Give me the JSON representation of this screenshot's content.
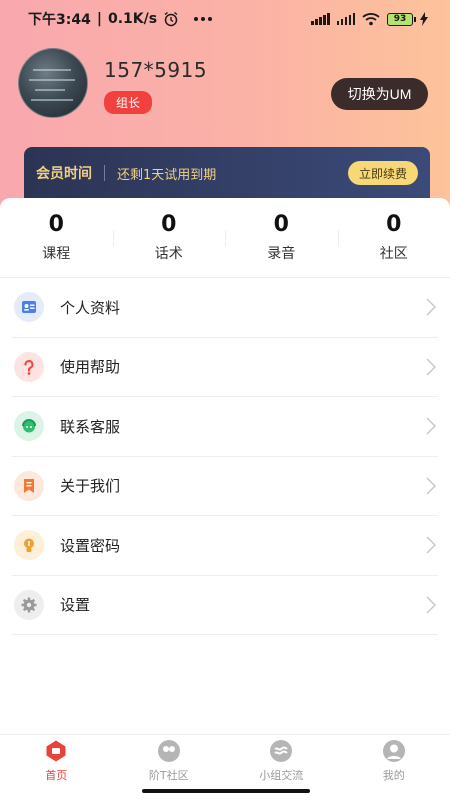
{
  "status_bar": {
    "time": "下午3:44",
    "speed": "0.1K/s",
    "battery": "93",
    "icons": [
      "alarm-icon",
      "more-dots-icon",
      "signal-icon",
      "hd-signal-icon",
      "wifi-icon",
      "battery-icon",
      "charging-icon"
    ]
  },
  "profile": {
    "username": "157*5915",
    "role": "组长",
    "switch_label": "切换为UM"
  },
  "membership": {
    "title": "会员时间",
    "description": "还剩1天试用到期",
    "renew_label": "立即续费"
  },
  "stats": [
    {
      "value": "0",
      "label": "课程"
    },
    {
      "value": "0",
      "label": "话术"
    },
    {
      "value": "0",
      "label": "录音"
    },
    {
      "value": "0",
      "label": "社区"
    }
  ],
  "menu": [
    {
      "label": "个人资料",
      "icon": "id-card-icon",
      "color": "#4d7fe8",
      "bg": "#e4ecfb"
    },
    {
      "label": "使用帮助",
      "icon": "question-icon",
      "color": "#ef4a45",
      "bg": "#fde3e2"
    },
    {
      "label": "联系客服",
      "icon": "customer-service-icon",
      "color": "#2fbf6e",
      "bg": "#dcf4e6"
    },
    {
      "label": "关于我们",
      "icon": "bookmark-icon",
      "color": "#ef7a3c",
      "bg": "#fde8dc"
    },
    {
      "label": "设置密码",
      "icon": "lightbulb-icon",
      "color": "#f0a030",
      "bg": "#fdefd8"
    },
    {
      "label": "设置",
      "icon": "gear-icon",
      "color": "#9a9a9a",
      "bg": "#eeeeee"
    }
  ],
  "tabs": [
    {
      "label": "首页",
      "icon": "home-icon",
      "active": true
    },
    {
      "label": "阶T社区",
      "icon": "community-icon",
      "active": false
    },
    {
      "label": "小组交流",
      "icon": "group-chat-icon",
      "active": false
    },
    {
      "label": "我的",
      "icon": "profile-icon",
      "active": false
    }
  ],
  "colors": {
    "accent": "#e8433a",
    "member_gold": "#f2d083",
    "member_bg": "#2c3454"
  }
}
